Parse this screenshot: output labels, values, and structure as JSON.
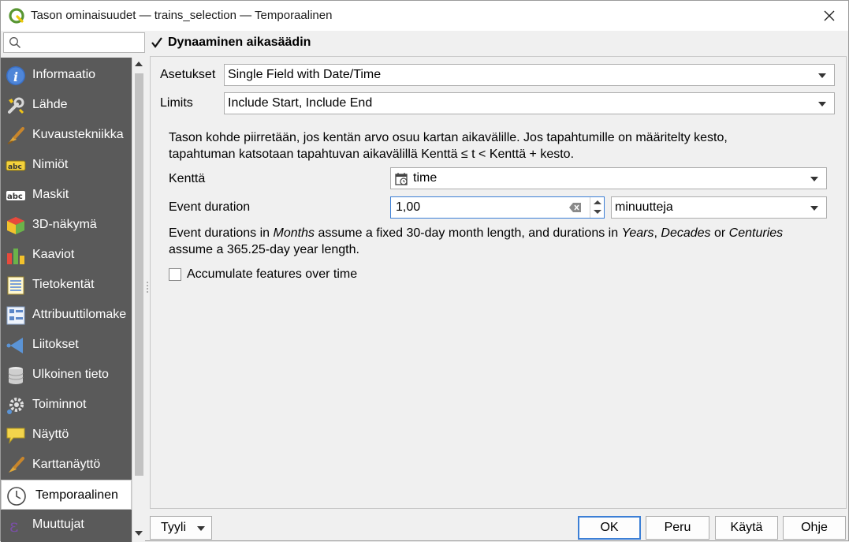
{
  "window": {
    "title": "Tason ominaisuudet — trains_selection — Temporaalinen"
  },
  "search": {
    "placeholder": "",
    "value": ""
  },
  "sidebar": {
    "items": [
      {
        "label": "Informaatio",
        "icon": "info-icon"
      },
      {
        "label": "Lähde",
        "icon": "source-wrench-icon"
      },
      {
        "label": "Kuvaustekniikka",
        "icon": "paintbrush-icon"
      },
      {
        "label": "Nimiöt",
        "icon": "labels-abc-icon"
      },
      {
        "label": "Maskit",
        "icon": "masks-abc-icon"
      },
      {
        "label": "3D-näkymä",
        "icon": "cube-3d-icon"
      },
      {
        "label": "Kaaviot",
        "icon": "diagrams-icon"
      },
      {
        "label": "Tietokentät",
        "icon": "fields-icon"
      },
      {
        "label": "Attribuuttilomake",
        "icon": "attribute-form-icon"
      },
      {
        "label": "Liitokset",
        "icon": "joins-icon"
      },
      {
        "label": "Ulkoinen tieto",
        "icon": "database-icon"
      },
      {
        "label": "Toiminnot",
        "icon": "actions-gear-icon"
      },
      {
        "label": "Näyttö",
        "icon": "display-speech-bubble-icon"
      },
      {
        "label": "Karttanäyttö",
        "icon": "map-tips-brush-icon"
      },
      {
        "label": "Temporaalinen",
        "icon": "clock-icon",
        "active": true
      },
      {
        "label": "Muuttujat",
        "icon": "variables-epsilon-icon"
      }
    ]
  },
  "temporal": {
    "enabled_label": "Dynaaminen aikasäädin",
    "enabled": true,
    "settings_label": "Asetukset",
    "settings_value": "Single Field with Date/Time",
    "limits_label": "Limits",
    "limits_value": "Include Start, Include End",
    "description_line1": "Tason kohde piirretään, jos kentän arvo osuu kartan aikavälille. Jos tapahtumille on määritelty kesto,",
    "description_line2": "tapahtuman katsotaan tapahtuvan aikavälillä Kenttä ≤ t < Kenttä + kesto.",
    "field_label": "Kenttä",
    "field_value": "time",
    "duration_label": "Event duration",
    "duration_value": "1,00",
    "duration_unit": "minuutteja",
    "note_part1": "Event durations in ",
    "note_months": "Months",
    "note_part2": " assume a fixed 30-day month length, and durations in ",
    "note_years": "Years",
    "note_comma": ", ",
    "note_decades": "Decades",
    "note_or": " or ",
    "note_centuries": "Centuries",
    "note_line2": "assume a 365.25-day year length.",
    "accumulate_label": "Accumulate features over time",
    "accumulate_checked": false
  },
  "buttons": {
    "style": "Tyyli",
    "ok": "OK",
    "cancel": "Peru",
    "apply": "Käytä",
    "help": "Ohje"
  },
  "colors": {
    "sidebar_bg": "#5a5a5a",
    "focus_blue": "#3c7fd6",
    "qgis_green": "#589632"
  }
}
